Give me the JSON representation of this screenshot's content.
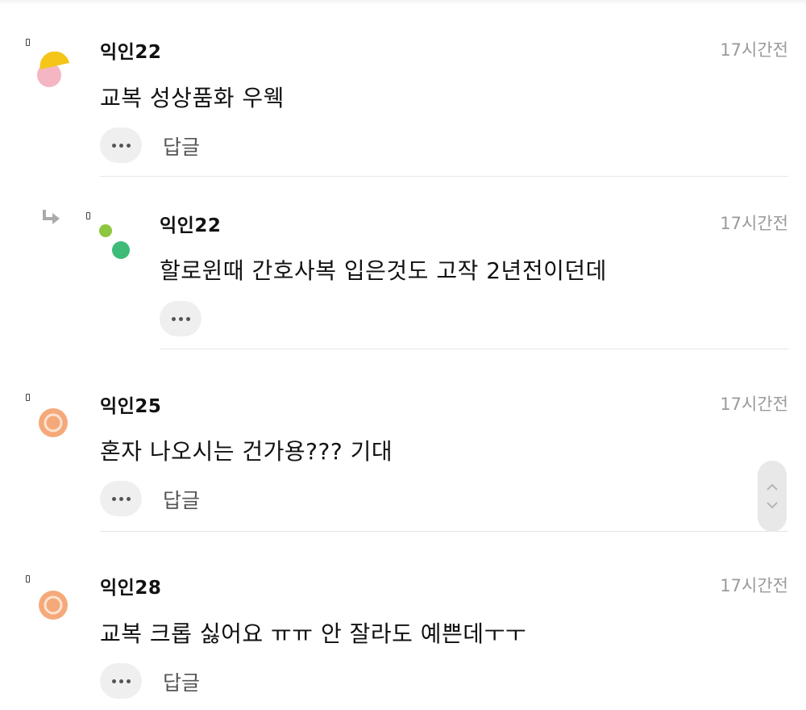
{
  "comments": [
    {
      "author": "익인22",
      "time": "17시간전",
      "text": "교복 성상품화 우웩",
      "reply_label": "답글"
    },
    {
      "author": "익인22",
      "time": "17시간전",
      "text": "할로윈때 간호사복 입은것도 고작 2년전이던데",
      "is_reply": true
    },
    {
      "author": "익인25",
      "time": "17시간전",
      "text": "혼자 나오시는 건가용??? 기대",
      "reply_label": "답글"
    },
    {
      "author": "익인28",
      "time": "17시간전",
      "text": "교복 크롭 싫어요 ㅠㅠ 안 잘라도 예쁜데ㅜㅜ",
      "reply_label": "답글"
    }
  ],
  "colors": {
    "avatar_yellow": "#f5c518",
    "avatar_pink": "#f4b6c2",
    "avatar_lime": "#8dc63f",
    "avatar_green": "#3dbb77",
    "avatar_orange": "#f5a97a"
  },
  "icons": {
    "more": "ellipsis-icon",
    "reply_arrow": "reply-arrow-icon",
    "scroll": "chevron-up-down-icon"
  }
}
